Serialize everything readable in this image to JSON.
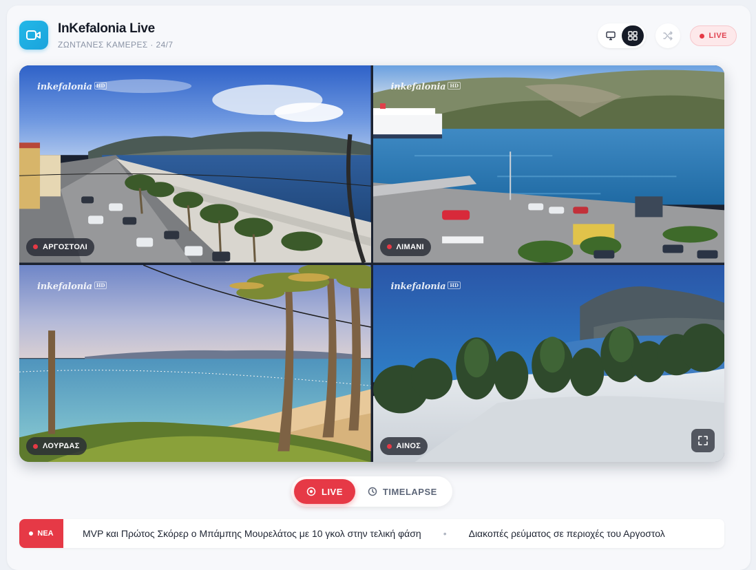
{
  "app": {
    "title": "InKefalonia Live",
    "subtitle": "ΖΩΝΤΑΝΕΣ ΚΑΜΕΡΕΣ · 24/7",
    "logo_icon": "video-camera-icon"
  },
  "toolbar": {
    "view_single_icon": "monitor-icon",
    "view_grid_icon": "grid-icon",
    "active_view": "grid",
    "shuffle_icon": "shuffle-icon",
    "live_label": "LIVE"
  },
  "cameras": [
    {
      "label": "ΑΡΓΟΣΤΟΛΙ",
      "watermark": "inkefalonia"
    },
    {
      "label": "ΛΙΜΑΝΙ",
      "watermark": "inkefalonia"
    },
    {
      "label": "ΛΟΥΡΔΑΣ",
      "watermark": "inkefalonia"
    },
    {
      "label": "ΑΙΝΟΣ",
      "watermark": "inkefalonia"
    }
  ],
  "mode_toggle": {
    "live_label": "LIVE",
    "timelapse_label": "TIMELAPSE",
    "active": "live"
  },
  "ticker": {
    "tag": "ΝΕΑ",
    "items": [
      "MVP και Πρώτος Σκόρερ ο Μπάμπης Μουρελάτος με 10 γκολ στην τελική φάση",
      "Διακοπές ρεύματος σε περιοχές του Αργοστολ"
    ]
  },
  "colors": {
    "accent": "#e63946",
    "brand": "#1aa3dc",
    "dark": "#161b27"
  }
}
